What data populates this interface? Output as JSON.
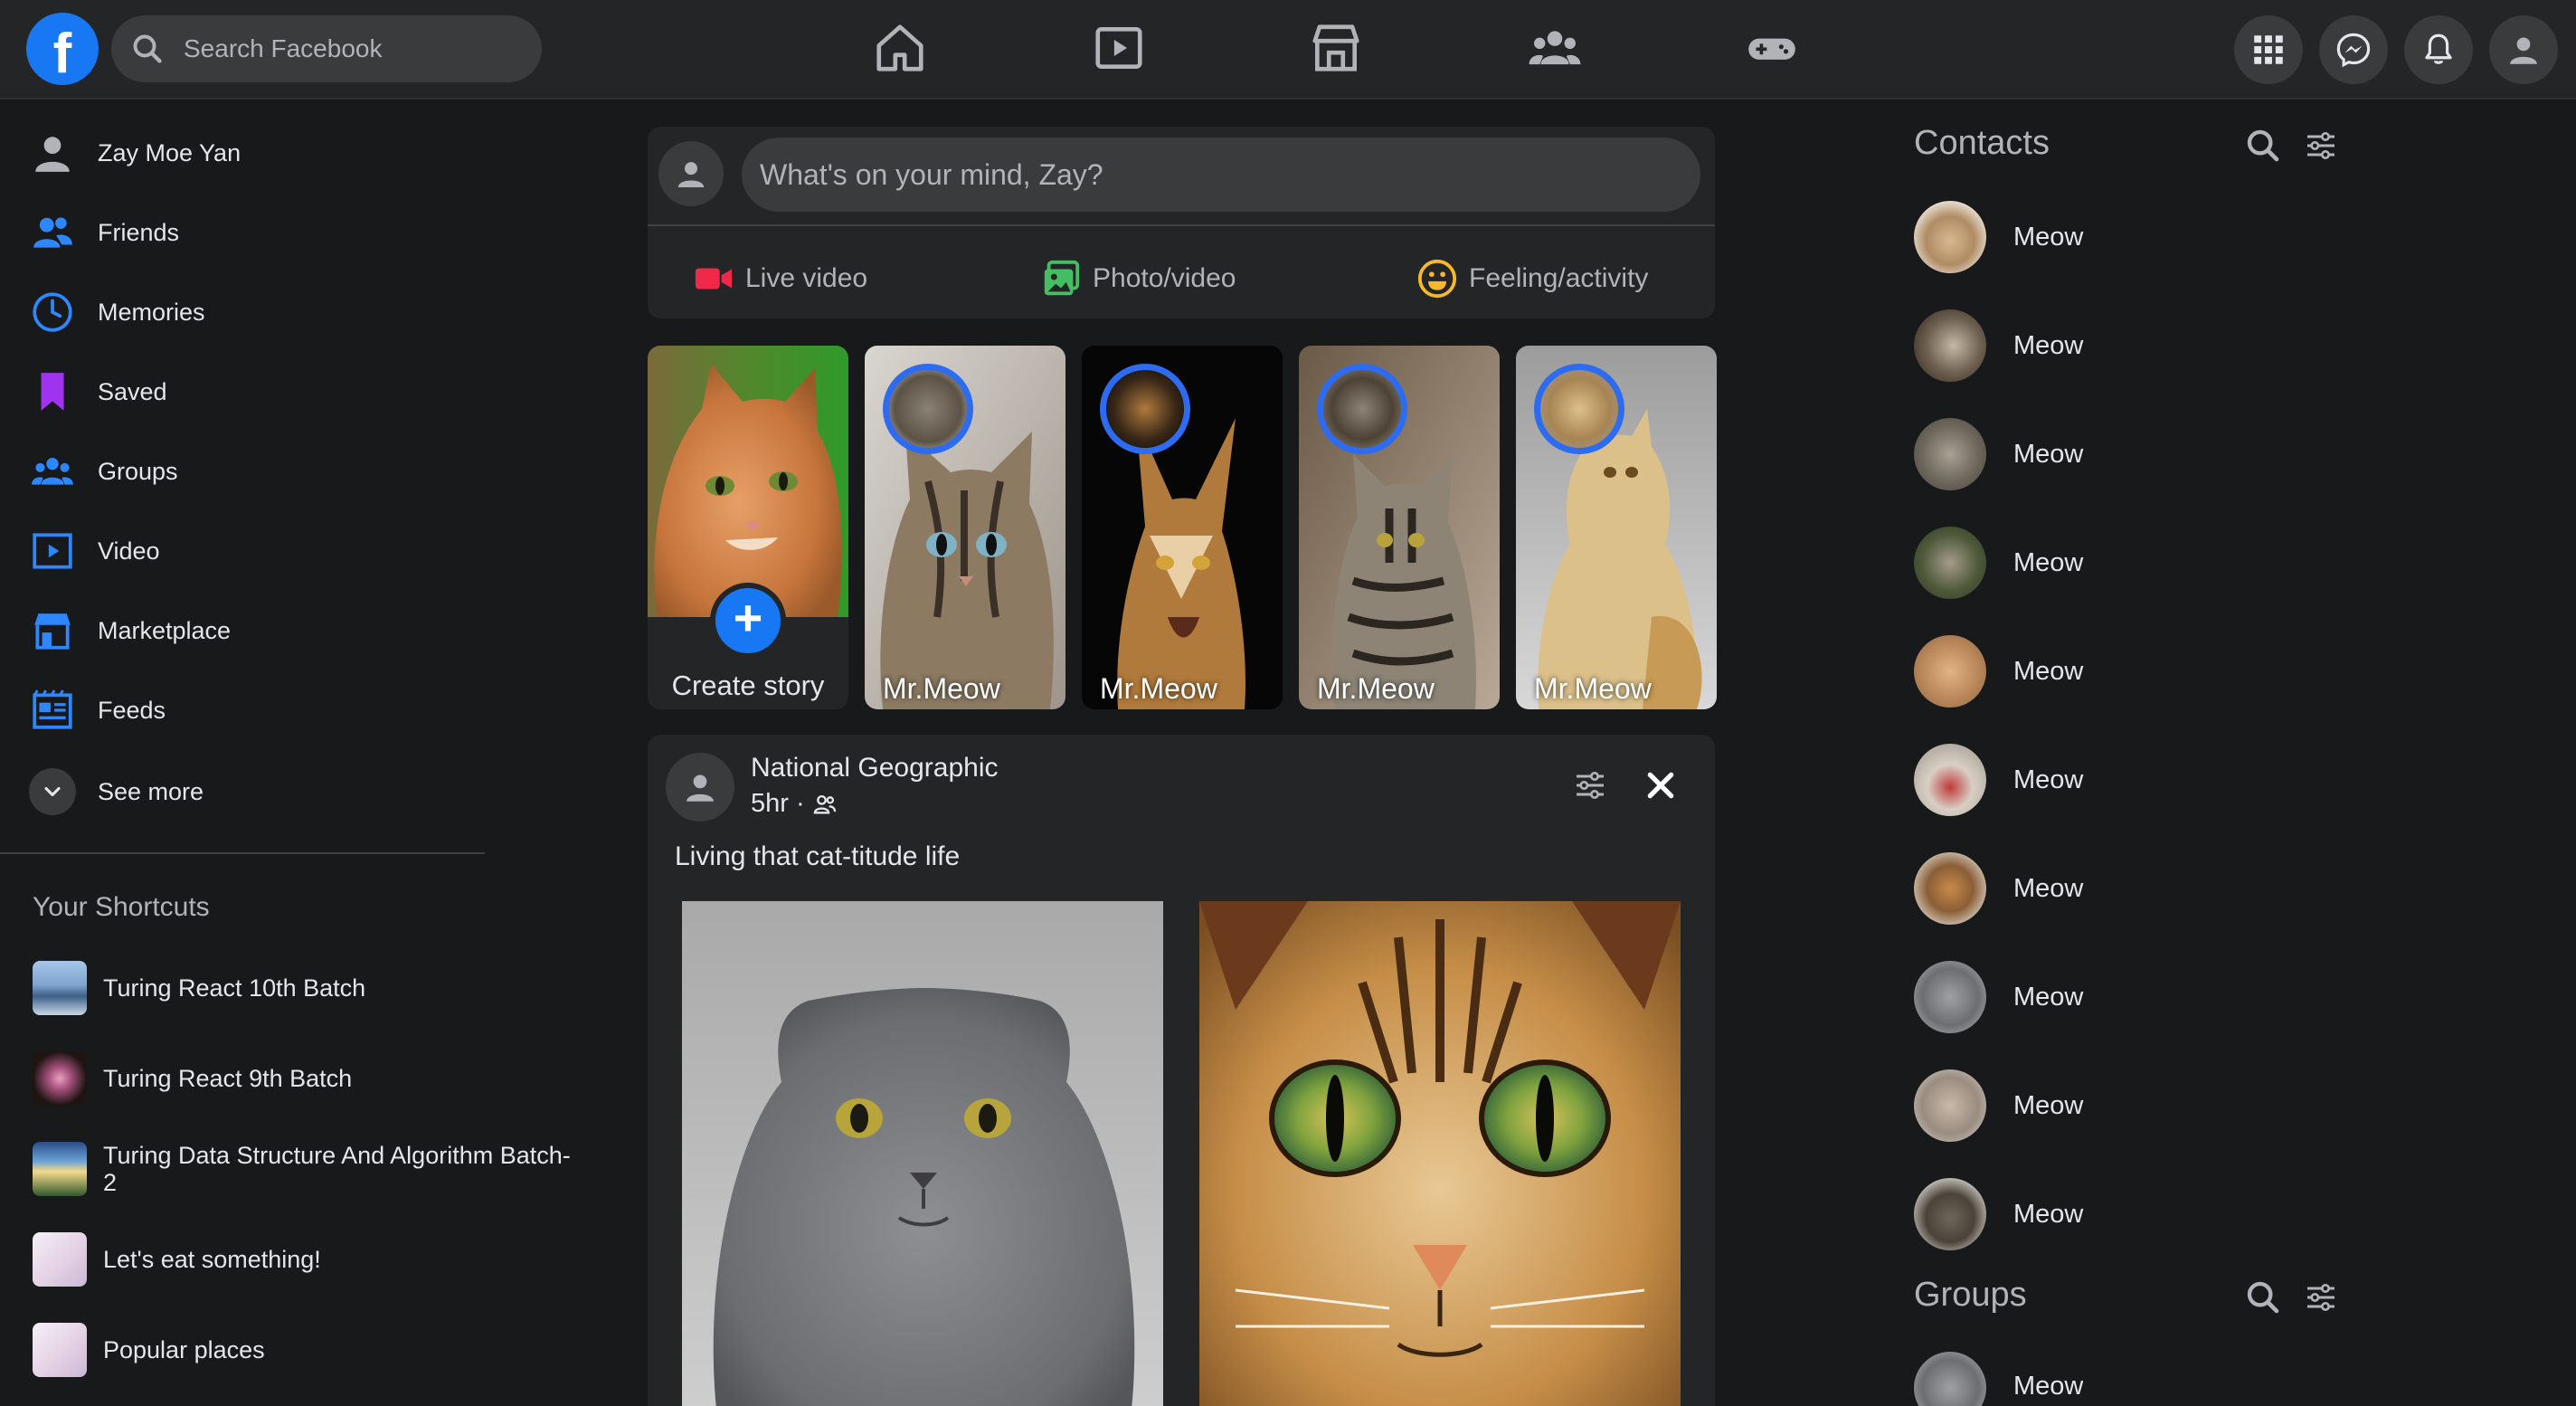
{
  "header": {
    "logo": "f",
    "search_placeholder": "Search Facebook",
    "nav_icons": [
      "home-icon",
      "video-icon",
      "marketplace-icon",
      "groups-icon",
      "gaming-icon"
    ],
    "right_icons": [
      "apps-grid-icon",
      "messenger-icon",
      "bell-icon",
      "account-icon"
    ]
  },
  "sidebar": {
    "items": [
      {
        "label": "Zay Moe Yan",
        "icon": "profile-icon"
      },
      {
        "label": "Friends",
        "icon": "friends-icon"
      },
      {
        "label": "Memories",
        "icon": "clock-icon"
      },
      {
        "label": "Saved",
        "icon": "bookmark-icon"
      },
      {
        "label": "Groups",
        "icon": "groups-icon"
      },
      {
        "label": "Video",
        "icon": "video-icon"
      },
      {
        "label": "Marketplace",
        "icon": "marketplace-icon"
      },
      {
        "label": "Feeds",
        "icon": "feeds-icon"
      },
      {
        "label": "See more",
        "icon": "chevron-down-icon"
      }
    ],
    "shortcuts_title": "Your Shortcuts",
    "shortcuts": [
      {
        "label": "Turing React 10th Batch"
      },
      {
        "label": "Turing React 9th Batch"
      },
      {
        "label": "Turing Data Structure And Algorithm Batch-2"
      },
      {
        "label": "Let's eat something!"
      },
      {
        "label": "Popular places"
      }
    ]
  },
  "composer": {
    "placeholder": "What's on your mind, Zay?",
    "actions": [
      {
        "label": "Live video",
        "icon": "live-video-icon",
        "color": "#f02849"
      },
      {
        "label": "Photo/video",
        "icon": "photo-icon",
        "color": "#45bd62"
      },
      {
        "label": "Feeling/activity",
        "icon": "smiley-icon",
        "color": "#f7b928"
      }
    ]
  },
  "stories": {
    "create_label": "Create story",
    "create_icon": "plus-icon",
    "items": [
      {
        "name": "Mr.Meow"
      },
      {
        "name": "Mr.Meow"
      },
      {
        "name": "Mr.Meow"
      },
      {
        "name": "Mr.Meow"
      }
    ]
  },
  "post": {
    "author": "National Geographic",
    "time": "5hr ·",
    "audience_icon": "friends-icon",
    "text": "Living that cat-titude life",
    "images": [
      "gray-cat-photo",
      "tabby-cat-closeup-photo"
    ]
  },
  "contacts": {
    "title": "Contacts",
    "items": [
      "Meow",
      "Meow",
      "Meow",
      "Meow",
      "Meow",
      "Meow",
      "Meow",
      "Meow",
      "Meow",
      "Meow"
    ]
  },
  "groups": {
    "title": "Groups",
    "items": [
      "Meow"
    ]
  },
  "colors": {
    "background": "#18191a",
    "surface": "#242526",
    "accent": "#1877f2",
    "story_ring": "#2d6bf0"
  }
}
